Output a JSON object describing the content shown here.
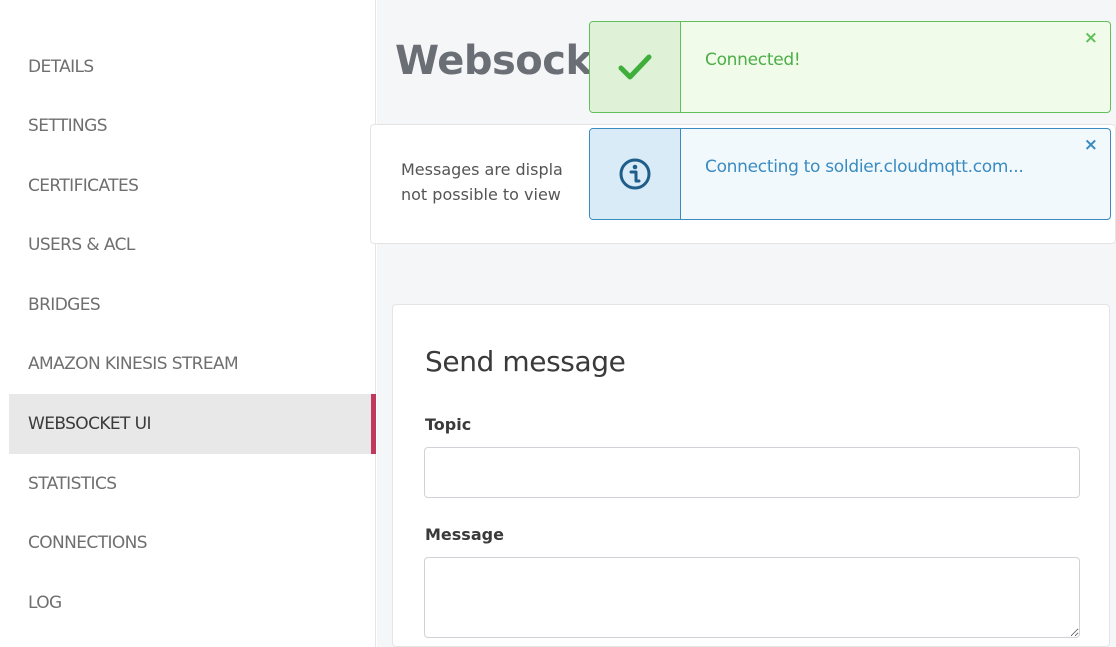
{
  "sidebar": {
    "items": [
      {
        "label": "DETAILS"
      },
      {
        "label": "SETTINGS"
      },
      {
        "label": "CERTIFICATES"
      },
      {
        "label": "USERS & ACL"
      },
      {
        "label": "BRIDGES"
      },
      {
        "label": "AMAZON KINESIS STREAM"
      },
      {
        "label": "WEBSOCKET UI",
        "active": true
      },
      {
        "label": "STATISTICS"
      },
      {
        "label": "CONNECTIONS"
      },
      {
        "label": "LOG"
      }
    ]
  },
  "main": {
    "page_title": "Websocke",
    "info_text_line1": "Messages are displa",
    "info_text_line2": "not possible to view"
  },
  "send_message": {
    "title": "Send message",
    "topic_label": "Topic",
    "topic_value": "",
    "message_label": "Message",
    "message_value": ""
  },
  "toasts": [
    {
      "type": "success",
      "text": "Connected!",
      "icon": "checkmark-icon",
      "close": "×"
    },
    {
      "type": "info",
      "text": "Connecting to soldier.cloudmqtt.com...",
      "icon": "info-icon",
      "close": "×"
    }
  ],
  "colors": {
    "active_accent": "#c0385d",
    "success": "#62c05a",
    "info": "#3a8bc0"
  }
}
